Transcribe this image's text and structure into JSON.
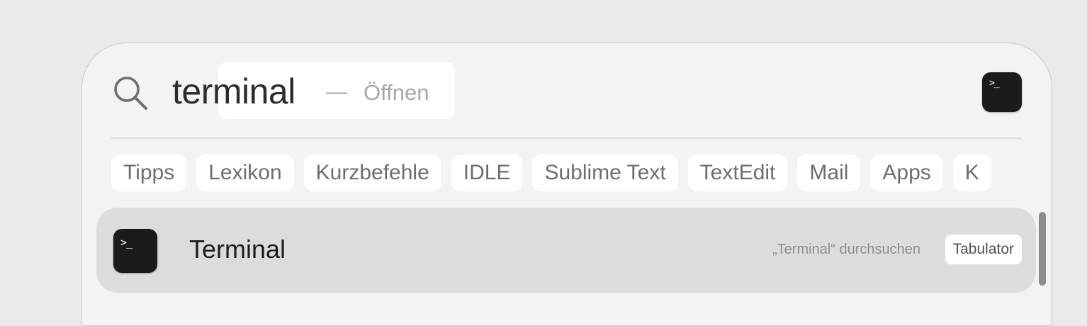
{
  "search": {
    "query": "terminal",
    "separator": "—",
    "action_hint": "Öffnen",
    "preview_icon_glyph": ">_"
  },
  "chips": [
    {
      "label": "Tipps"
    },
    {
      "label": "Lexikon"
    },
    {
      "label": "Kurzbefehle"
    },
    {
      "label": "IDLE"
    },
    {
      "label": "Sublime Text"
    },
    {
      "label": "TextEdit"
    },
    {
      "label": "Mail"
    },
    {
      "label": "Apps"
    },
    {
      "label": "K"
    }
  ],
  "results": [
    {
      "title": "Terminal",
      "icon_glyph": ">_",
      "search_hint": "„Terminal“ durchsuchen",
      "key_hint": "Tabulator"
    }
  ],
  "colors": {
    "background": "#e9eaec",
    "panel": "#f2f3f4",
    "selected_row": "#dcdcdd",
    "chip": "#ffffff",
    "icon": "#1b1b1d"
  },
  "icons": {
    "search": "search-icon",
    "app": "terminal-app-icon"
  }
}
